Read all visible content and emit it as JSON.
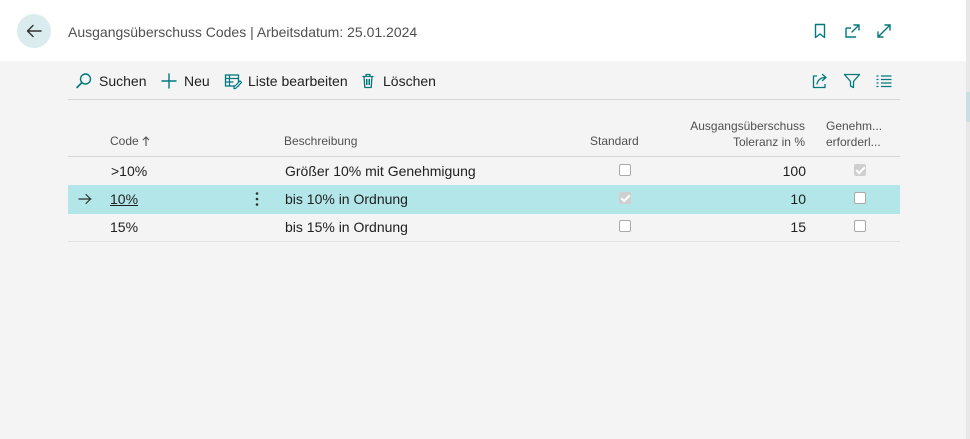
{
  "header": {
    "title": "Ausgangsüberschuss Codes | Arbeitsdatum: 25.01.2024"
  },
  "toolbar": {
    "search_label": "Suchen",
    "new_label": "Neu",
    "edit_list_label": "Liste bearbeiten",
    "delete_label": "Löschen"
  },
  "table": {
    "columns": {
      "code": "Code",
      "description": "Beschreibung",
      "standard": "Standard",
      "tolerance_line1": "Ausgangsüberschuss",
      "tolerance_line2": "Toleranz in %",
      "approval_line1": "Genehm...",
      "approval_line2": "erforderl..."
    },
    "rows": [
      {
        "code": ">10%",
        "description": "Größer 10% mit Genehmigung",
        "standard": false,
        "tolerance": "100",
        "approval": true
      },
      {
        "code": "10%",
        "description": "bis 10% in Ordnung",
        "standard": true,
        "tolerance": "10",
        "approval": false,
        "selected": true
      },
      {
        "code": "15%",
        "description": "bis 15% in Ordnung",
        "standard": false,
        "tolerance": "15",
        "approval": false
      }
    ]
  },
  "colors": {
    "accent": "#00797e",
    "selected_row": "#b2e6e9",
    "back_button_bg": "#dbecee"
  },
  "icons": {
    "back": "arrow-left-icon",
    "bookmark": "bookmark-icon",
    "open_new": "open-in-new-window-icon",
    "expand": "expand-icon",
    "search": "search-icon",
    "new": "plus-icon",
    "edit_list": "edit-list-icon",
    "delete": "trash-icon",
    "share": "share-icon",
    "filter": "filter-icon",
    "list_view": "list-view-icon",
    "sort": "sort-ascending-icon",
    "row_indicator": "row-arrow-icon",
    "row_menu": "more-vertical-icon"
  }
}
